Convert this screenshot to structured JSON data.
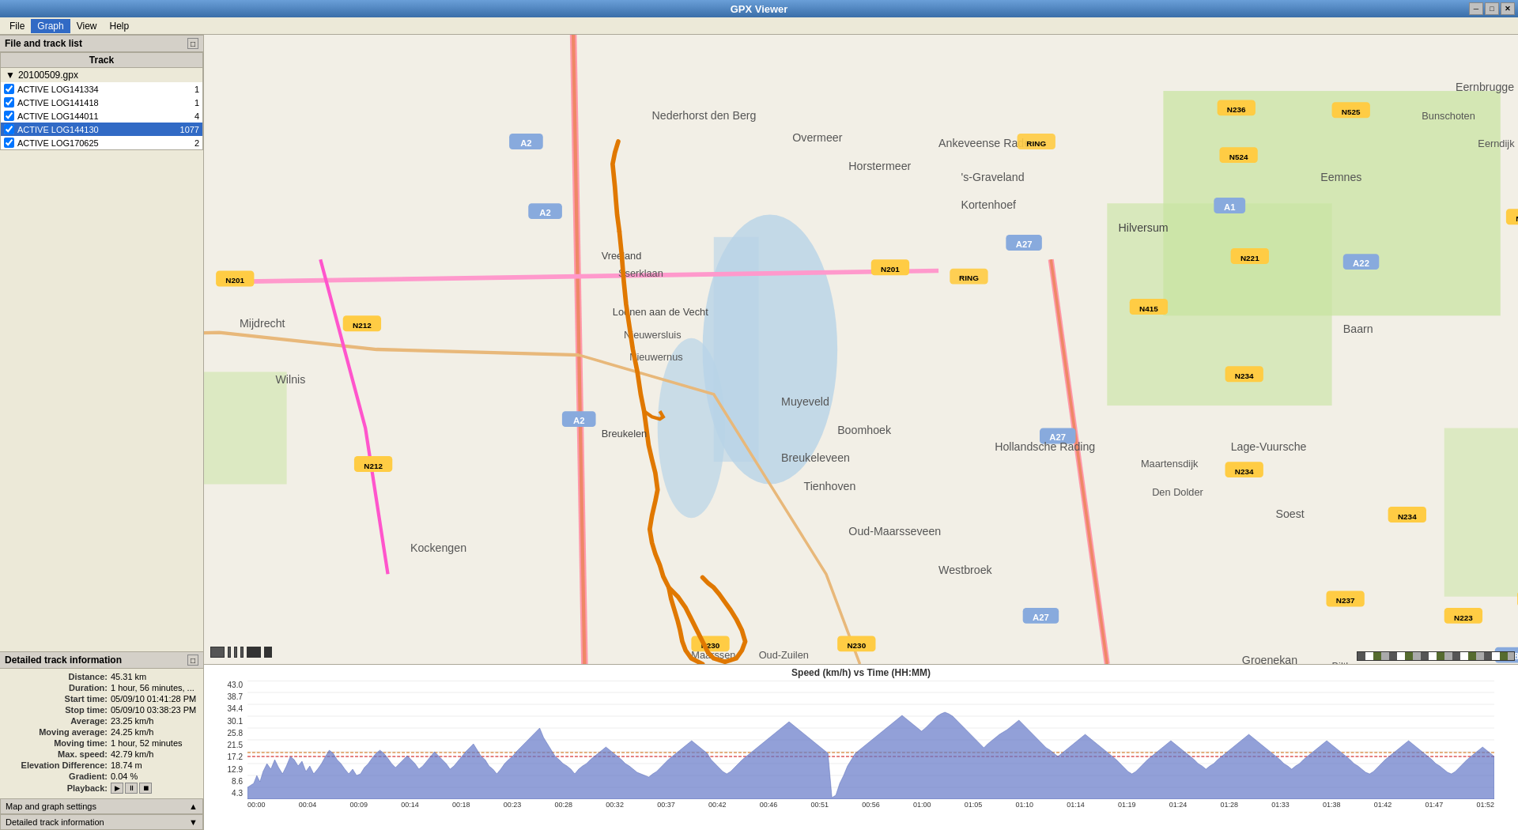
{
  "app": {
    "title": "GPX Viewer"
  },
  "titlebar": {
    "minimize": "─",
    "maximize": "□",
    "close": "✕"
  },
  "menu": {
    "items": [
      "File",
      "Graph",
      "View",
      "Help"
    ]
  },
  "left_panel": {
    "file_track_section_label": "File and track list",
    "track_column_header": "Track",
    "file": {
      "name": "20100509.gpx",
      "expanded": true
    },
    "tracks": [
      {
        "id": "t1",
        "name": "ACTIVE LOG141334",
        "num": "1",
        "checked": true,
        "selected": false
      },
      {
        "id": "t2",
        "name": "ACTIVE LOG141418",
        "num": "1",
        "checked": true,
        "selected": false
      },
      {
        "id": "t3",
        "name": "ACTIVE LOG144011",
        "num": "4",
        "checked": true,
        "selected": false
      },
      {
        "id": "t4",
        "name": "ACTIVE LOG144130",
        "num": "1077",
        "checked": true,
        "selected": true
      },
      {
        "id": "t5",
        "name": "ACTIVE LOG170625",
        "num": "2",
        "checked": true,
        "selected": false
      }
    ]
  },
  "detailed_info": {
    "section_label": "Detailed track information",
    "fields": [
      {
        "label": "Distance:",
        "value": "45.31 km"
      },
      {
        "label": "Duration:",
        "value": "1 hour, 56 minutes, ..."
      },
      {
        "label": "Start time:",
        "value": "05/09/10 01:41:28 PM"
      },
      {
        "label": "Stop time:",
        "value": "05/09/10 03:38:23 PM"
      },
      {
        "label": "Average:",
        "value": "23.25 km/h"
      },
      {
        "label": "Moving average:",
        "value": "24.25 km/h"
      },
      {
        "label": "Moving time:",
        "value": "1 hour, 52 minutes"
      },
      {
        "label": "Max. speed:",
        "value": "42.79 km/h"
      },
      {
        "label": "Elevation Difference:",
        "value": "18.74 m"
      },
      {
        "label": "Gradient:",
        "value": "0.04 %"
      },
      {
        "label": "Playback:",
        "value": ""
      }
    ]
  },
  "bottom_buttons": [
    {
      "id": "map-graph-settings",
      "label": "Map and graph settings"
    },
    {
      "id": "detailed-track-info",
      "label": "Detailed track information"
    }
  ],
  "graph": {
    "title": "Speed (km/h) vs Time (HH:MM)",
    "y_axis": [
      "43.0",
      "38.7",
      "34.4",
      "30.1",
      "25.8",
      "21.5",
      "17.2",
      "12.9",
      "8.6",
      "4.3"
    ],
    "x_axis": [
      "00:00",
      "00:04",
      "00:09",
      "00:14",
      "00:18",
      "00:23",
      "00:28",
      "00:32",
      "00:37",
      "00:42",
      "00:46",
      "00:51",
      "00:56",
      "01:00",
      "01:05",
      "01:10",
      "01:14",
      "01:19",
      "01:24",
      "01:28",
      "01:33",
      "01:38",
      "01:42",
      "01:47",
      "01:52"
    ]
  }
}
